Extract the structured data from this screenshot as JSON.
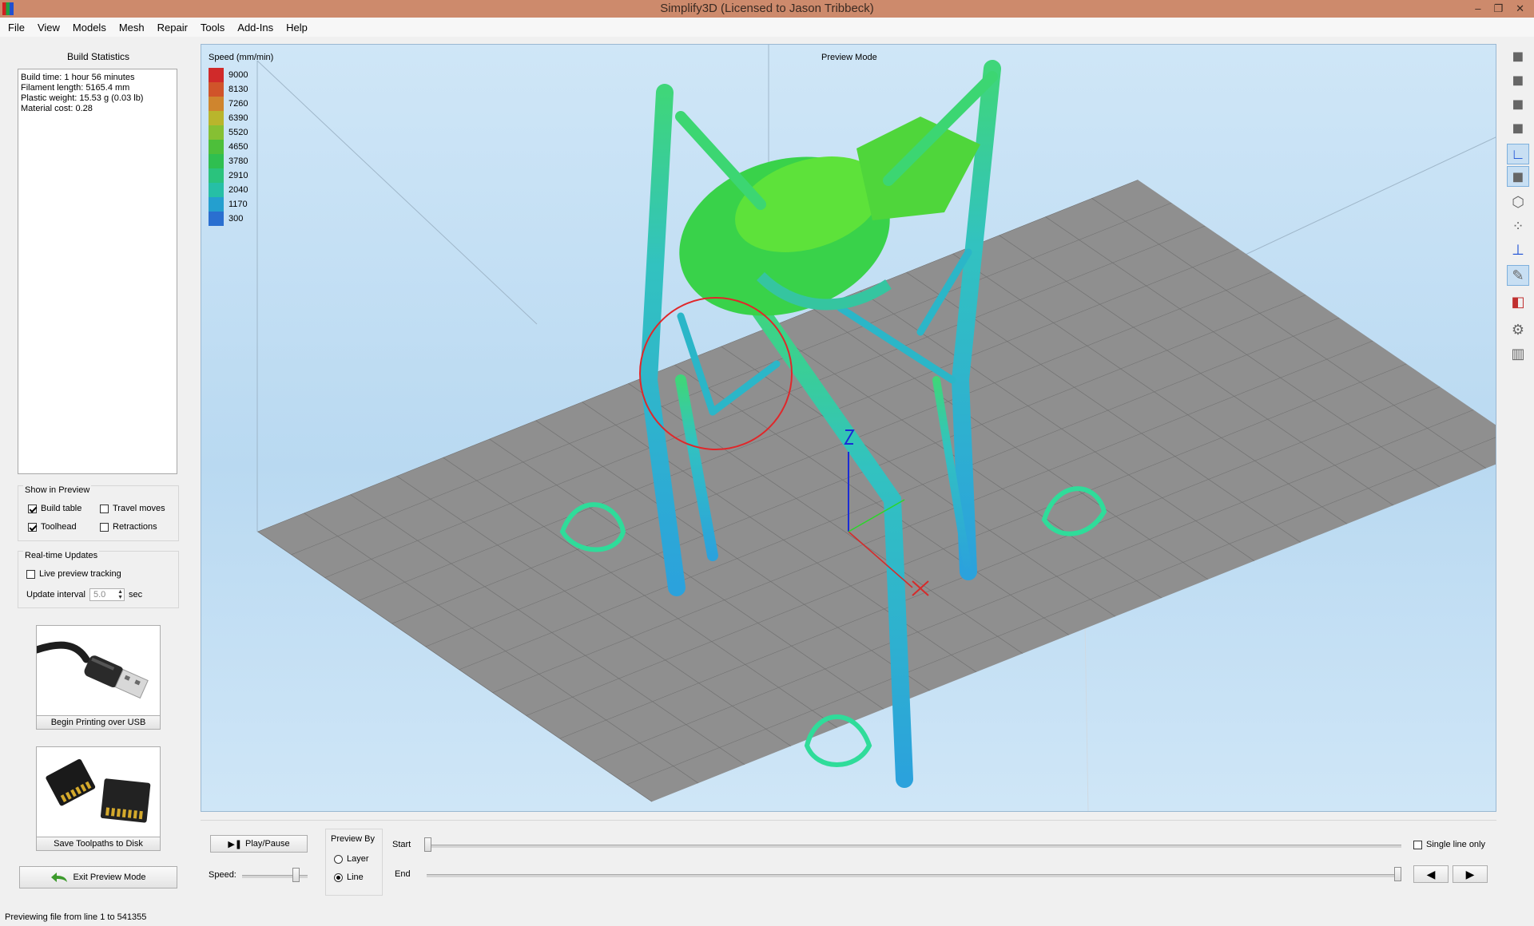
{
  "window": {
    "title": "Simplify3D (Licensed to Jason Tribbeck)",
    "minimize": "–",
    "restore": "❐",
    "close": "✕"
  },
  "menu": [
    "File",
    "View",
    "Models",
    "Mesh",
    "Repair",
    "Tools",
    "Add-Ins",
    "Help"
  ],
  "build_statistics": {
    "title": "Build Statistics",
    "lines": [
      "Build time: 1 hour 56 minutes",
      "Filament length: 5165.4 mm",
      "Plastic weight: 15.53 g (0.03 lb)",
      "Material cost: 0.28"
    ]
  },
  "show_in_preview": {
    "title": "Show in Preview",
    "build_table": "Build table",
    "travel_moves": "Travel moves",
    "toolhead": "Toolhead",
    "retractions": "Retractions",
    "build_table_checked": true,
    "travel_moves_checked": false,
    "toolhead_checked": true,
    "retractions_checked": false
  },
  "realtime": {
    "title": "Real-time Updates",
    "live_tracking": "Live preview tracking",
    "live_tracking_checked": false,
    "interval_label": "Update interval",
    "interval_value": "5.0",
    "interval_unit": "sec"
  },
  "actions": {
    "usb": "Begin Printing over USB",
    "disk": "Save Toolpaths to Disk",
    "exit": "Exit Preview Mode"
  },
  "viewport": {
    "mode_label": "Preview Mode",
    "legend_title": "Speed (mm/min)",
    "legend": [
      {
        "value": "9000",
        "color": "#d02a2a"
      },
      {
        "value": "8130",
        "color": "#d0542a"
      },
      {
        "value": "7260",
        "color": "#cf852e"
      },
      {
        "value": "6390",
        "color": "#b9b52c"
      },
      {
        "value": "5520",
        "color": "#86c033"
      },
      {
        "value": "4650",
        "color": "#4dbf3a"
      },
      {
        "value": "3780",
        "color": "#2fbf50"
      },
      {
        "value": "2910",
        "color": "#2ac37d"
      },
      {
        "value": "2040",
        "color": "#26bfa6"
      },
      {
        "value": "1170",
        "color": "#249fcf"
      },
      {
        "value": "300",
        "color": "#2a6fd0"
      }
    ]
  },
  "controls": {
    "play_pause": "Play/Pause",
    "speed_label": "Speed:",
    "preview_by_title": "Preview By",
    "layer": "Layer",
    "line": "Line",
    "layer_checked": false,
    "line_checked": true,
    "start_label": "Start",
    "end_label": "End",
    "single_line": "Single line only",
    "single_line_checked": false
  },
  "status": "Previewing file from line 1 to 541355"
}
